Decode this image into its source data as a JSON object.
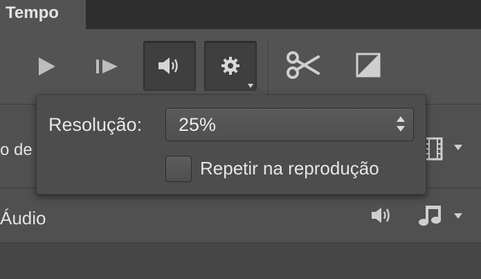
{
  "panel": {
    "tab_title": "Tempo"
  },
  "toolbar": {
    "play_icon": "play-icon",
    "step_icon": "step-forward-icon",
    "audio_icon": "speaker-icon",
    "settings_icon": "gear-icon",
    "cut_icon": "scissors-icon",
    "transition_icon": "transition-icon"
  },
  "tracks": {
    "video_label": "o de",
    "audio_label": "Áudio"
  },
  "popover": {
    "resolution_label": "Resolução:",
    "resolution_value": "25%",
    "loop_label": "Repetir na reprodução",
    "loop_checked": false
  },
  "colors": {
    "panel_bg": "#535353",
    "popover_bg": "#4d4d4d",
    "text": "#e6e6e6"
  }
}
